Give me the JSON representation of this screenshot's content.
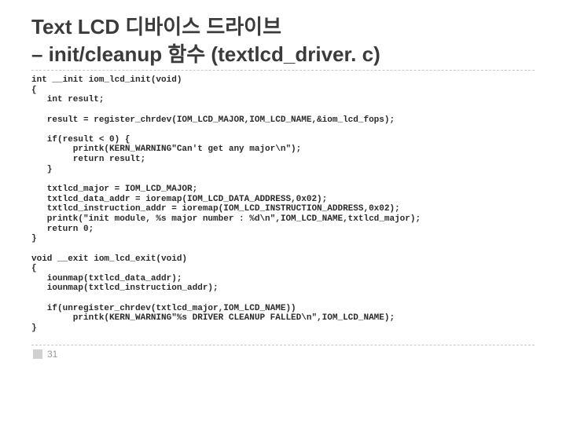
{
  "title": {
    "line1": "Text LCD 디바이스 드라이브",
    "line2": "– init/cleanup 함수 (textlcd_driver. c)"
  },
  "code": "int __init iom_lcd_init(void)\n{\n   int result;\n\n   result = register_chrdev(IOM_LCD_MAJOR,IOM_LCD_NAME,&iom_lcd_fops);\n\n   if(result < 0) {\n        printk(KERN_WARNING\"Can't get any major\\n\");\n        return result;\n   }\n\n   txtlcd_major = IOM_LCD_MAJOR;\n   txtlcd_data_addr = ioremap(IOM_LCD_DATA_ADDRESS,0x02);\n   txtlcd_instruction_addr = ioremap(IOM_LCD_INSTRUCTION_ADDRESS,0x02);\n   printk(\"init module, %s major number : %d\\n\",IOM_LCD_NAME,txtlcd_major);\n   return 0;\n}\n\nvoid __exit iom_lcd_exit(void)\n{\n   iounmap(txtlcd_data_addr);\n   iounmap(txtlcd_instruction_addr);\n\n   if(unregister_chrdev(txtlcd_major,IOM_LCD_NAME))\n        printk(KERN_WARNING\"%s DRIVER CLEANUP FALLED\\n\",IOM_LCD_NAME);\n}",
  "page": "31"
}
